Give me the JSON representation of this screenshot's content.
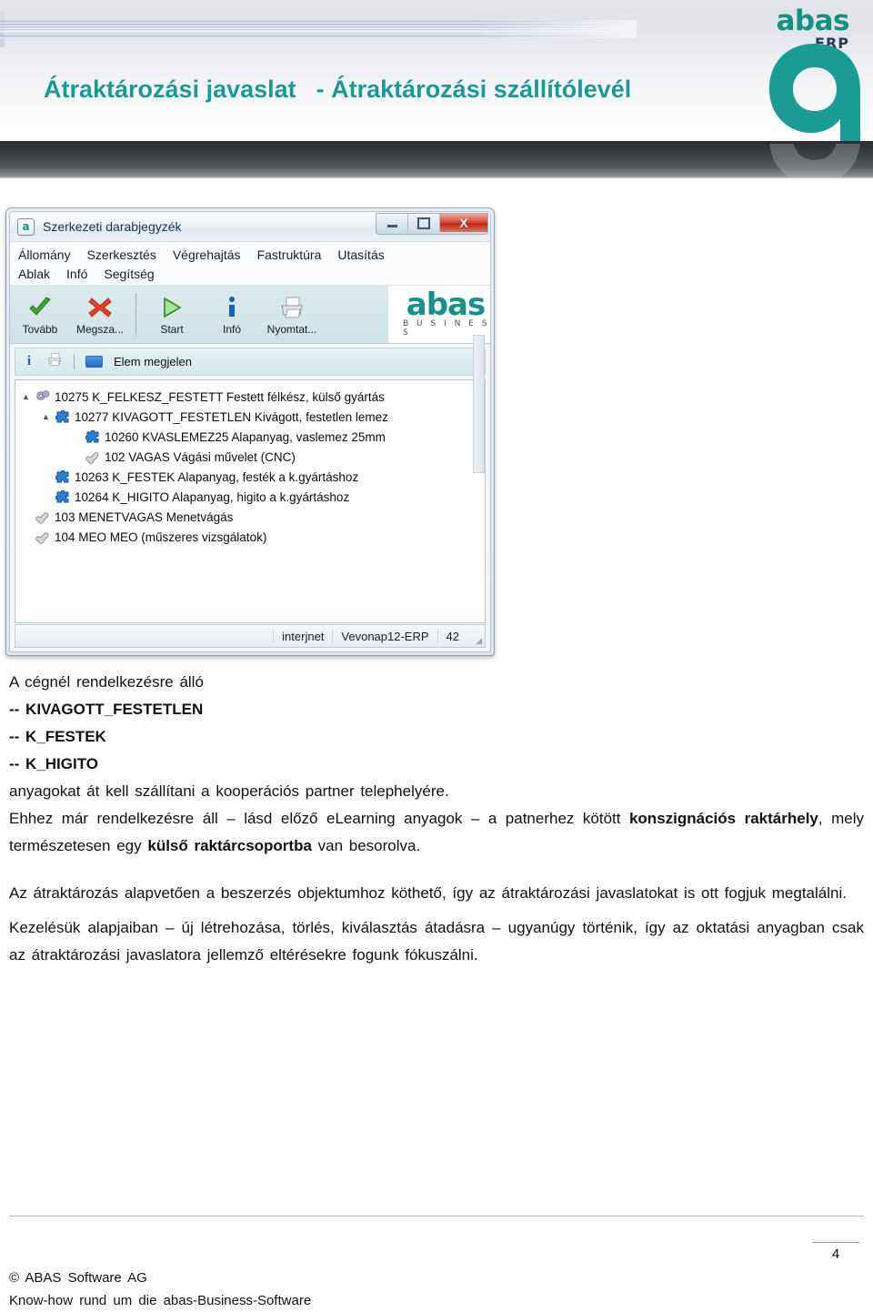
{
  "banner": {
    "logo": {
      "brand": "abas",
      "product": "ERP"
    },
    "title_left": "Átraktározási javaslat",
    "title_right": "- Átraktározási szállítólevél",
    "mark_letter": "a"
  },
  "app_window": {
    "title": "Szerkezeti darabjegyzék",
    "title_icon": "abas-app-icon",
    "window_controls": {
      "minimize": "–",
      "maximize": "□",
      "close": "X"
    },
    "menu_row1": [
      "Állomány",
      "Szerkesztés",
      "Végrehajtás",
      "Fastruktúra",
      "Utasítás"
    ],
    "menu_row2": [
      "Ablak",
      "Infó",
      "Segítség"
    ],
    "toolbar": [
      {
        "label": "Tovább",
        "icon": "green-check-icon"
      },
      {
        "label": "Megsza...",
        "icon": "red-cross-icon"
      },
      {
        "label": "Start",
        "icon": "green-play-icon"
      },
      {
        "label": "Infó",
        "icon": "info-i-icon"
      },
      {
        "label": "Nyomtat...",
        "icon": "printer-icon"
      }
    ],
    "toolbar_logo": {
      "word": "abas",
      "sub": "B U S I N E S S"
    },
    "subtoolbar": {
      "info_icon": "info-i-icon",
      "print_icon": "printer-icon",
      "chip_icon": "blue-chip-icon",
      "label": "Elem megjelen"
    },
    "tree": [
      {
        "indent": 0,
        "arrow": "▲",
        "icon": "gears-icon",
        "text": "10275 K_FELKESZ_FESTETT Festett félkész, külső gyártás"
      },
      {
        "indent": 1,
        "arrow": "▲",
        "icon": "puzzle-icon",
        "text": "10277 KIVAGOTT_FESTETLEN Kivágott, festetlen lemez"
      },
      {
        "indent": 2,
        "arrow": "",
        "icon": "puzzle-icon",
        "text": "10260 KVASLEMEZ25 Alapanyag, vaslemez 25mm"
      },
      {
        "indent": 2,
        "arrow": "",
        "icon": "wrench-icon",
        "text": "102 VAGAS Vágási művelet (CNC)"
      },
      {
        "indent": 1,
        "arrow": "",
        "icon": "puzzle-icon",
        "text": "10263 K_FESTEK Alapanyag, festék a k.gyártáshoz"
      },
      {
        "indent": 1,
        "arrow": "",
        "icon": "puzzle-icon",
        "text": "10264 K_HIGITO Alapanyag, higito a k.gyártáshoz"
      },
      {
        "indent": 0,
        "arrow": "",
        "icon": "wrench-icon",
        "text": "103 MENETVAGAS Menetvágás"
      },
      {
        "indent": 0,
        "arrow": "",
        "icon": "wrench-icon",
        "text": "104 MEO MEO (műszeres vizsgálatok)"
      }
    ],
    "statusbar": {
      "cells": [
        "interjnet",
        "Vevonap12-ERP",
        "42"
      ]
    }
  },
  "document": {
    "p1_line1": "A cégnél rendelkezésre álló",
    "p1_item1": "--  KIVAGOTT_FESTETLEN",
    "p1_item2": "-- K_FESTEK",
    "p1_item3": "-- K_HIGITO",
    "p1_line5": "anyagokat át kell szállítani a kooperációs partner telephelyére.",
    "p2_a": "Ehhez már rendelkezésre áll – lásd előző eLearning anyagok – a patnerhez kötött ",
    "p2_b1": "konszignációs raktárhely",
    "p2_c": ", mely természetesen egy ",
    "p2_b2": "külső raktárcsoportba",
    "p2_d": " van besorolva.",
    "p3": "Az átraktározás alapvetően a beszerzés objektumhoz köthető, így az átraktározási javaslatokat is ott fogjuk megtalálni.",
    "p4": "Kezelésük alapjaiban – új létrehozása, törlés, kiválasztás átadásra – ugyanúgy történik, így az oktatási anyagban csak az átraktározási javaslatora jellemző eltérésekre fogunk fókuszálni."
  },
  "footer": {
    "page_number": "4",
    "line1": "© ABAS Software AG",
    "line2": "Know-how rund um die abas-Business-Software"
  },
  "colors": {
    "brand_teal": "#189a96",
    "logo_green": "#109285",
    "title_text": "#189a96",
    "menu_text": "#14202c",
    "toolbar_bg": "#d6e9ec"
  }
}
